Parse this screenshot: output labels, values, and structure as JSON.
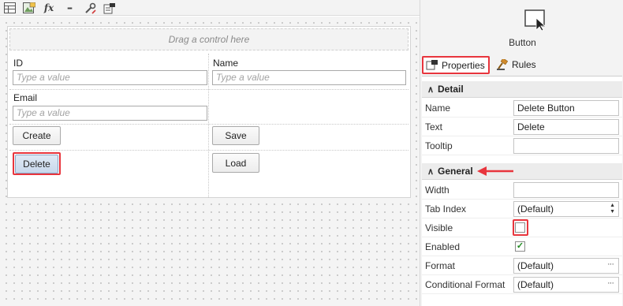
{
  "toolbar": {
    "icons": [
      "form-table-icon",
      "image-upload-icon",
      "expression-icon",
      "more-icon",
      "tools-icon",
      "rules-icon"
    ],
    "expression_label": "fx",
    "more_label": "▪▪▪"
  },
  "form": {
    "drop_placeholder": "Drag a control here",
    "fields": [
      {
        "label": "ID",
        "placeholder": "Type a value"
      },
      {
        "label": "Name",
        "placeholder": "Type a value"
      },
      {
        "label": "Email",
        "placeholder": "Type a value"
      }
    ],
    "buttons": {
      "create": "Create",
      "save": "Save",
      "delete": "Delete",
      "load": "Load"
    }
  },
  "panel": {
    "control_type": "Button",
    "tabs": [
      {
        "label": "Properties",
        "active": true
      },
      {
        "label": "Rules",
        "active": false
      }
    ],
    "sections": {
      "detail": {
        "title": "Detail",
        "rows": [
          {
            "label": "Name",
            "value": "Delete Button"
          },
          {
            "label": "Text",
            "value": "Delete"
          },
          {
            "label": "Tooltip",
            "value": ""
          }
        ]
      },
      "general": {
        "title": "General",
        "width_label": "Width",
        "width_value": "",
        "tab_index_label": "Tab Index",
        "tab_index_value": "(Default)",
        "visible_label": "Visible",
        "visible_checked": false,
        "enabled_label": "Enabled",
        "enabled_checked": true,
        "format_label": "Format",
        "format_value": "(Default)",
        "conditional_format_label": "Conditional Format",
        "conditional_format_value": "(Default)"
      }
    }
  },
  "colors": {
    "highlight": "#e8353d",
    "checkmark": "#1f8a1f",
    "selected_button": "#c8d8ec"
  }
}
